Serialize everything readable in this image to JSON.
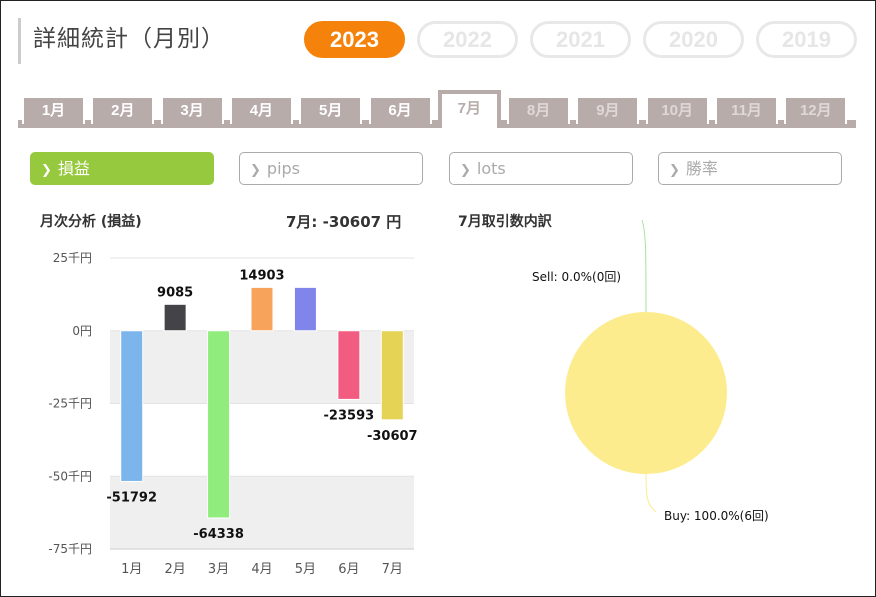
{
  "page": {
    "title": "詳細統計（月別）"
  },
  "years": [
    {
      "label": "2023",
      "active": true
    },
    {
      "label": "2022",
      "active": false
    },
    {
      "label": "2021",
      "active": false
    },
    {
      "label": "2020",
      "active": false
    },
    {
      "label": "2019",
      "active": false
    }
  ],
  "months": [
    {
      "label": "1月",
      "state": "enabled"
    },
    {
      "label": "2月",
      "state": "enabled"
    },
    {
      "label": "3月",
      "state": "enabled"
    },
    {
      "label": "4月",
      "state": "enabled"
    },
    {
      "label": "5月",
      "state": "enabled"
    },
    {
      "label": "6月",
      "state": "enabled"
    },
    {
      "label": "7月",
      "state": "active"
    },
    {
      "label": "8月",
      "state": "disabled"
    },
    {
      "label": "9月",
      "state": "disabled"
    },
    {
      "label": "10月",
      "state": "disabled"
    },
    {
      "label": "11月",
      "state": "disabled"
    },
    {
      "label": "12月",
      "state": "disabled"
    }
  ],
  "metrics": [
    {
      "label": "損益",
      "active": true
    },
    {
      "label": "pips",
      "active": false
    },
    {
      "label": "lots",
      "active": false
    },
    {
      "label": "勝率",
      "active": false
    }
  ],
  "monthly_analysis": {
    "title": "月次分析 (損益)",
    "summary": "7月:  -30607 円"
  },
  "trade_breakdown": {
    "title": "7月取引数内訳"
  },
  "colors": {
    "accent": "#f5820b",
    "metric_active": "#96c93d",
    "tab": "#b8acab"
  },
  "chart_data": [
    {
      "type": "bar",
      "categories": [
        "1月",
        "2月",
        "3月",
        "4月",
        "5月",
        "6月",
        "7月"
      ],
      "values": [
        -51792,
        9085,
        -64338,
        14903,
        14903,
        -23593,
        -30607
      ],
      "data_labels": [
        "-51792",
        "9085",
        "-64338",
        "14903",
        "",
        "-23593",
        "-30607"
      ],
      "bar_colors": [
        "#7cb5ec",
        "#434348",
        "#90ed7d",
        "#f7a35c",
        "#8085e9",
        "#f15c80",
        "#e4d354"
      ],
      "yticks": [
        "25千円",
        "0円",
        "-25千円",
        "-50千円",
        "-75千円"
      ],
      "ytick_values": [
        25000,
        0,
        -25000,
        -50000,
        -75000
      ],
      "ylim": [
        -75000,
        25000
      ],
      "grid": true
    },
    {
      "type": "pie",
      "labels": [
        "Sell",
        "Buy"
      ],
      "values": [
        0.0,
        100.0
      ],
      "data_labels": [
        "Sell: 0.0%(0回)",
        "Buy: 100.0%(6回)"
      ],
      "colors": [
        "#a6e3a1",
        "#fdec8d"
      ]
    }
  ]
}
